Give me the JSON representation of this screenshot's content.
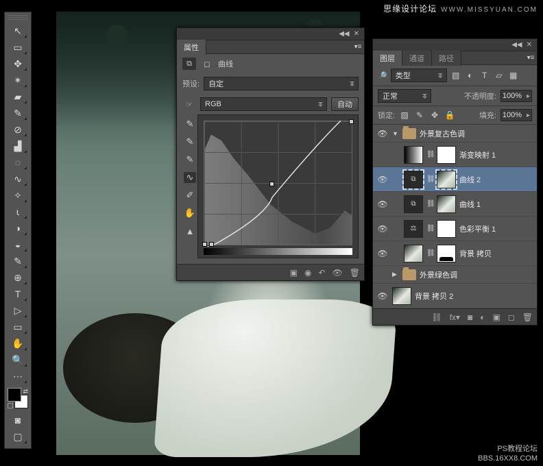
{
  "watermark": {
    "site": "思缘设计论坛",
    "url_top": "WWW.MISSYUAN.COM",
    "bottom1": "PS教程论坛",
    "bottom2": "BBS.16XX8.COM"
  },
  "toolbox": {
    "icons": [
      "↖",
      "▭",
      "✥",
      "✴",
      "▰",
      "✎",
      "⊘",
      "▟",
      "◌",
      "∿",
      "✧",
      "⍳",
      "◑",
      "◒",
      "✎",
      "⊕",
      "T",
      "▷",
      "▭",
      "✋",
      "🔍",
      "⋯"
    ]
  },
  "properties": {
    "title": "属性",
    "type_label": "曲线",
    "preset_label": "预设:",
    "preset_value": "自定",
    "channel": "RGB",
    "auto": "自动"
  },
  "layers": {
    "tabs": [
      "图层",
      "通道",
      "路径"
    ],
    "kind": "类型",
    "blend": "正常",
    "opacity_label": "不透明度:",
    "opacity": "100%",
    "fill_label": "填充:",
    "fill": "100%",
    "lock_label": "锁定:",
    "items": {
      "grp1": "外景复古色调",
      "l_grad": "渐变映射 1",
      "l_c2": "曲线 2",
      "l_c1": "曲线 1",
      "l_bal": "色彩平衡 1",
      "l_bgcp": "背景 拷贝",
      "grp2": "外景绿色调",
      "l_bgcp2": "背景 拷贝 2"
    }
  },
  "chart_data": {
    "type": "line",
    "title": "曲线",
    "xlabel": "",
    "ylabel": "",
    "xlim": [
      0,
      255
    ],
    "ylim": [
      0,
      255
    ],
    "series": [
      {
        "name": "RGB",
        "points": [
          [
            0,
            0
          ],
          [
            13,
            0
          ],
          [
            127,
            100
          ],
          [
            255,
            255
          ]
        ]
      }
    ],
    "histogram_note": "shadow-weighted histogram displayed behind curve"
  }
}
